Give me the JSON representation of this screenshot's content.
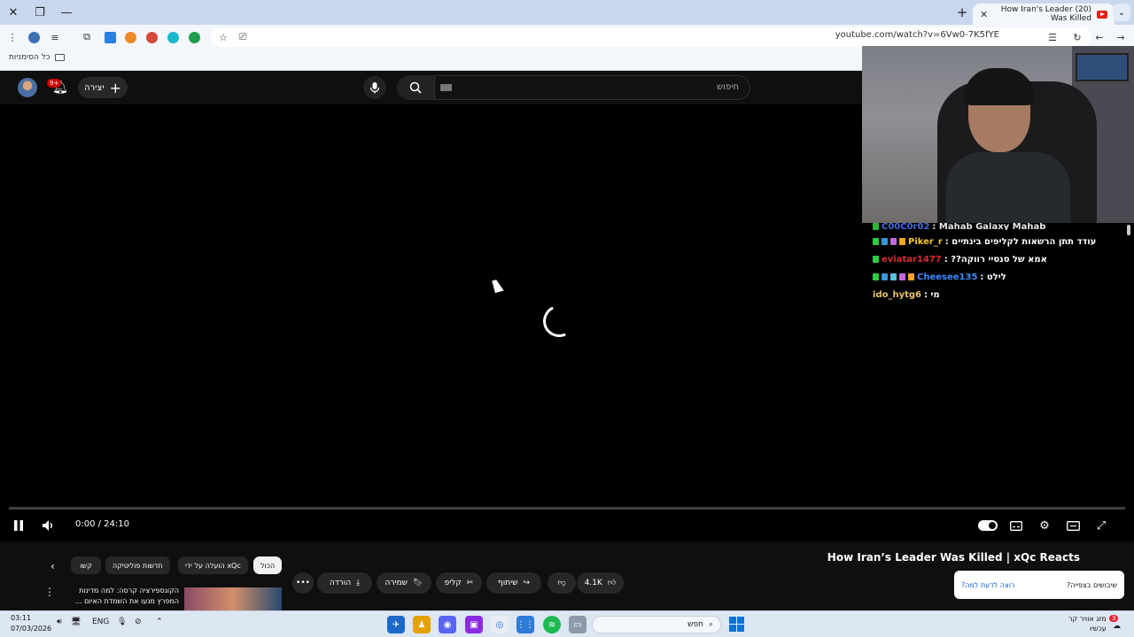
{
  "browser": {
    "tab_title": "(20) How Iran's Leader Was Killed",
    "url": "youtube.com/watch?v=6Vw0-7K5fYE",
    "bookmarks_label": "כל הסימניות"
  },
  "youtube": {
    "create_label": "יצירה",
    "notification_count": "9+",
    "search_placeholder": "חיפוש",
    "video_title": "How Iran’s Leader Was Killed | xQc Reacts",
    "time_display": "0:00 / 24:10",
    "like_count": "4.1K",
    "share_label": "שיתוף",
    "clip_label": "קליפ",
    "save_label": "שמירה",
    "download_label": "הורדה",
    "chips": [
      "הכול",
      "הועלה על ידי xQc",
      "חדשות פוליטיקה",
      "קשו"
    ],
    "recommended_title": "הקונספירציה קרסה: למה מדינות המפרץ מנעו את השמדת האיום ...",
    "toast_question": "שיבושים בצפייה?",
    "toast_link": "רוצה לדעת למה?"
  },
  "chat": {
    "lines": [
      {
        "user": "C00C0r02",
        "message": ": Mahab Galaxy Mahab",
        "color": "#4a78ff"
      },
      {
        "user": "Piker_r",
        "message": ": עודד תתן הרשאות לקליפים בינתיים",
        "color": "#f4c430"
      },
      {
        "user": "eviatar1477",
        "message": ": ??אמא של סנסיי רווקה",
        "color": "#e0282e"
      },
      {
        "user": "Cheesee135",
        "message": ": לילט",
        "color": "#3d8bff"
      },
      {
        "user": "ido_hytg6",
        "message": ": מי",
        "color": "#e8c16a"
      }
    ]
  },
  "taskbar": {
    "time": "03:11",
    "date": "07/03/2026",
    "language": "ENG",
    "search_label": "חפש",
    "weather_line1": "מזג אוויר קר",
    "weather_line2": "עכשיו",
    "notify_count": "3"
  },
  "colors": {
    "yt_background": "#0f0f0f",
    "yt_red": "#e62117",
    "chrome_tabbar": "#c9d7ee",
    "taskbar": "#dde6f3",
    "link_blue": "#065fd4"
  },
  "icons": [
    "close-icon",
    "maximize-icon",
    "minimize-icon",
    "menu-icon",
    "new-tab-icon",
    "tab-search-icon",
    "star-icon",
    "reload-icon",
    "back-icon",
    "forward-icon",
    "mic-icon",
    "search-icon",
    "bell-icon",
    "pause-icon",
    "volume-icon",
    "fullscreen-icon",
    "settings-icon",
    "captions-icon",
    "theater-icon",
    "like-icon",
    "dislike-icon",
    "share-icon",
    "clip-icon",
    "save-icon",
    "download-icon",
    "more-icon",
    "windows-start-icon"
  ]
}
